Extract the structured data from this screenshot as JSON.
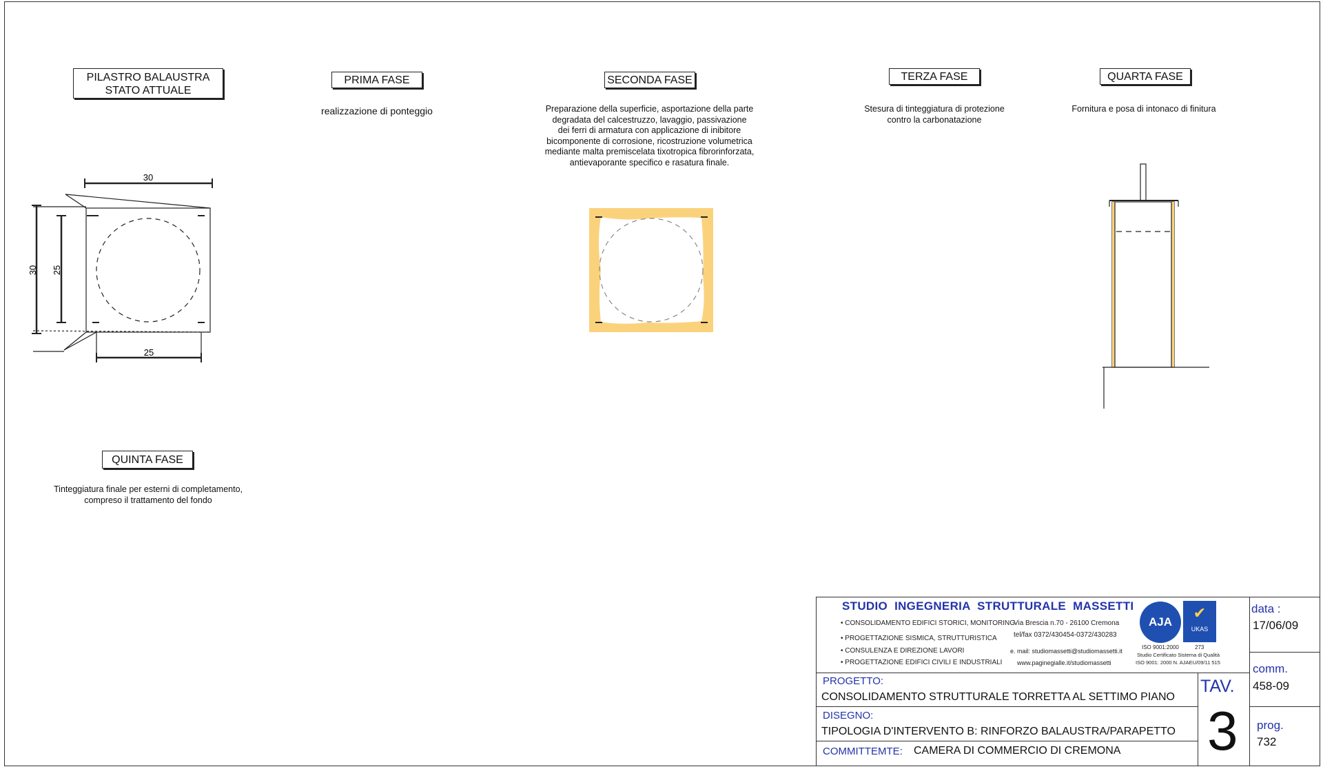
{
  "phases": {
    "stato_attuale": {
      "title_line1": "PILASTRO BALAUSTRA",
      "title_line2": "STATO ATTUALE"
    },
    "prima": {
      "title": "PRIMA FASE",
      "desc": "realizzazione di ponteggio"
    },
    "seconda": {
      "title": "SECONDA FASE",
      "desc_lines": [
        "Preparazione della superficie, asportazione della parte",
        "degradata del calcestruzzo, lavaggio, passivazione",
        "dei ferri di armatura con applicazione di inibitore",
        "bicomponente di corrosione, ricostruzione volumetrica",
        "mediante malta premiscelata tixotropica fibrorinforzata,",
        "antievaporante specifico e rasatura finale."
      ]
    },
    "terza": {
      "title": "TERZA FASE",
      "desc_lines": [
        "Stesura di tinteggiatura di protezione",
        "contro la carbonatazione"
      ]
    },
    "quarta": {
      "title": "QUARTA FASE",
      "desc": "Fornitura e posa di intonaco di finitura"
    },
    "quinta": {
      "title": "QUINTA FASE",
      "desc_lines": [
        "Tinteggiatura finale per esterni di completamento,",
        "compreso il trattamento del fondo"
      ]
    }
  },
  "dimensions": {
    "top_width": "30",
    "left_height": "30",
    "inner_height": "25",
    "bottom_width": "25"
  },
  "title_block": {
    "studio_name": "STUDIO  INGEGNERIA  STRUTTURALE  MASSETTI",
    "services": [
      "• CONSOLIDAMENTO EDIFICI STORICI, MONITORING",
      "• PROGETTAZIONE SISMICA, STRUTTURISTICA",
      "• CONSULENZA E DIREZIONE LAVORI",
      "• PROGETTAZIONE EDIFICI CIVILI E INDUSTRIALI"
    ],
    "address": "Via Brescia n.70 - 26100 Cremona",
    "telfax": "tel/fax 0372/430454-0372/430283",
    "email": "e. mail: studiomassetti@studiomassetti.it",
    "web": "www.paginegialle.it/studiomassetti",
    "cert_aja": "AJA",
    "cert_ukas": "UKAS",
    "iso_label": "ISO 9001:2000",
    "cert_num": "273",
    "cert_line1": "Studio Certificato Sistema di Qualità",
    "cert_line2": "ISO 9001: 2000  N. AJAEU/09/11 515",
    "progetto_label": "PROGETTO:",
    "progetto_value": "CONSOLIDAMENTO STRUTTURALE TORRETTA AL SETTIMO PIANO",
    "disegno_label": "DISEGNO:",
    "disegno_value": "TIPOLOGIA D'INTERVENTO B: RINFORZO BALAUSTRA/PARAPETTO",
    "committente_label": "COMMITTEMTE:",
    "committente_value": "CAMERA DI COMMERCIO DI CREMONA",
    "tav_label": "TAV.",
    "tav_value": "3",
    "data_label": "data :",
    "data_value": "17/06/09",
    "comm_label": "comm.",
    "comm_value": "458-09",
    "prog_label": "prog.",
    "prog_value": "732"
  },
  "colors": {
    "repair_fill": "#fbd27c",
    "title_blue": "#2233aa"
  }
}
